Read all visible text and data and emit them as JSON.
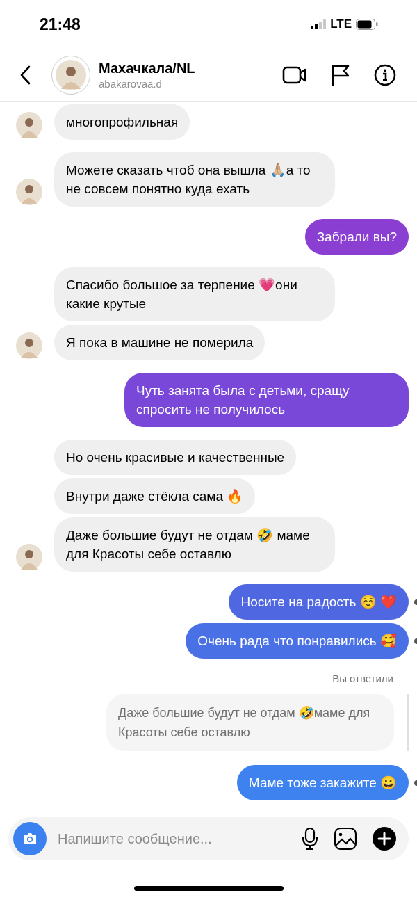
{
  "status_bar": {
    "time": "21:48",
    "network": "LTE"
  },
  "header": {
    "title": "Махачкала/NL",
    "username": "abakarovaa.d"
  },
  "messages": [
    {
      "kind": "in",
      "text": "многопрофильная",
      "avatar": true
    },
    {
      "kind": "in",
      "text": "Можете сказать чтоб она вышла 🙏🏼а то не совсем понятно куда ехать",
      "avatar": true
    },
    {
      "kind": "out",
      "text": "Забрали вы?",
      "color": "#8b3ed2",
      "status_dot": false
    },
    {
      "kind": "in",
      "text": "Спасибо большое за терпение 💗они какие крутые",
      "avatar": false
    },
    {
      "kind": "in",
      "text": "Я пока в машине не померила",
      "avatar": true
    },
    {
      "kind": "out",
      "text": "Чуть занята была с детьми, сращу спросить не получилось",
      "color": "#7a48d8",
      "status_dot": false
    },
    {
      "kind": "in",
      "text": "Но очень красивые и качественные",
      "avatar": false
    },
    {
      "kind": "in",
      "text": "Внутри даже стёкла сама 🔥",
      "avatar": false
    },
    {
      "kind": "in",
      "text": "Даже большие будут не отдам 🤣 маме для Красоты себе оставлю",
      "avatar": true
    },
    {
      "kind": "out",
      "text": "Носите на радость ☺️ ❤️",
      "color": "#4f67e0",
      "status_dot": true
    },
    {
      "kind": "out",
      "text": "Очень рада что понравились 🥰",
      "color": "#4a70e5",
      "status_dot": true
    },
    {
      "kind": "reply",
      "label": "Вы ответили",
      "quote": "Даже большие будут не отдам 🤣маме для Красоты себе оставлю"
    },
    {
      "kind": "out",
      "text": "Маме тоже закажите 😀",
      "color": "#3e82f0",
      "status_dot": true
    }
  ],
  "composer": {
    "placeholder": "Напишите сообщение..."
  }
}
